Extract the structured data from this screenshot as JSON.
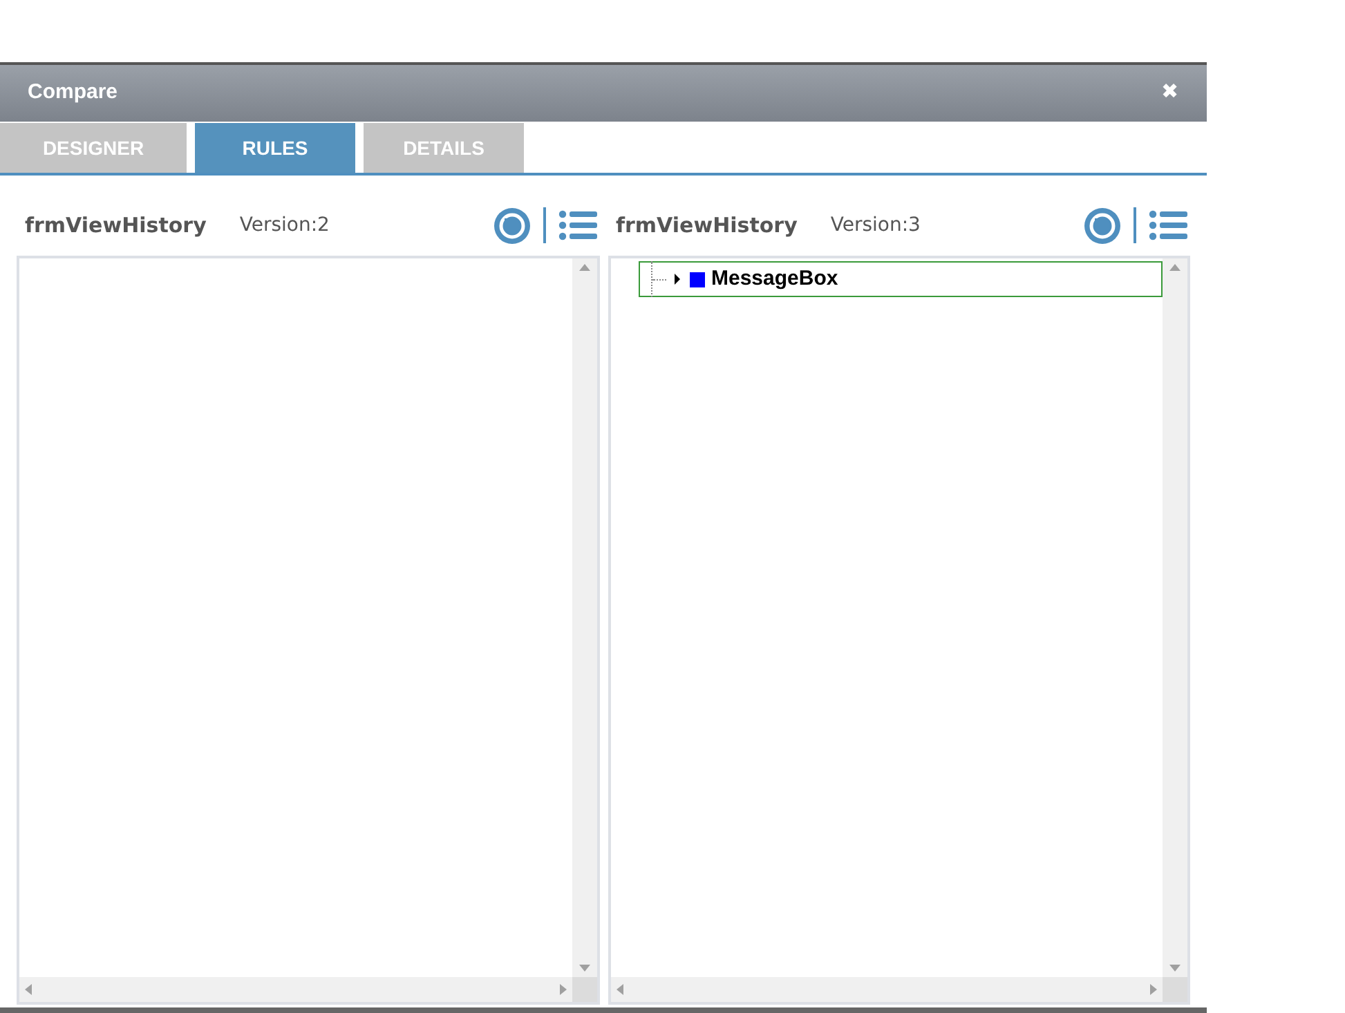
{
  "window": {
    "title": "Compare",
    "close": "✖"
  },
  "tabs": [
    {
      "label": "DESIGNER",
      "selected": false
    },
    {
      "label": "RULES",
      "selected": true
    },
    {
      "label": "DETAILS",
      "selected": false
    }
  ],
  "panels": [
    {
      "title": "frmViewHistory",
      "version": "Version:2"
    },
    {
      "title": "frmViewHistory",
      "version": "Version:3",
      "tree": [
        {
          "label": "MessageBox",
          "color": "#0000ff",
          "selected": true,
          "expanded": false
        }
      ]
    }
  ]
}
